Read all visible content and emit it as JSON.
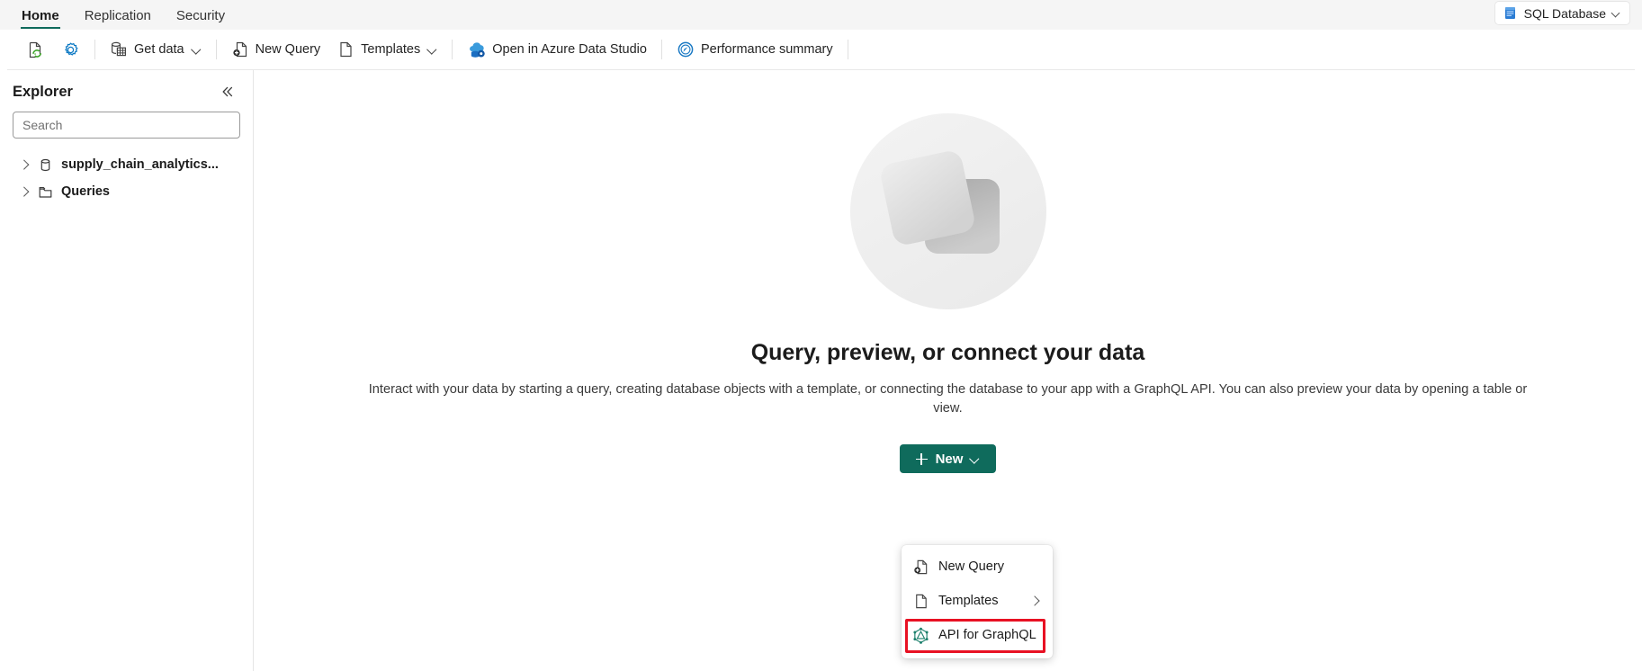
{
  "tabs": [
    {
      "label": "Home",
      "active": true
    },
    {
      "label": "Replication",
      "active": false
    },
    {
      "label": "Security",
      "active": false
    }
  ],
  "database_badge": {
    "label": "SQL Database",
    "icon": "database-icon",
    "chevron": "chevron-down-icon"
  },
  "toolbar": [
    {
      "name": "refresh",
      "label": "",
      "icon": "refresh-icon"
    },
    {
      "name": "settings",
      "label": "",
      "icon": "gear-icon"
    },
    {
      "name": "get-data",
      "label": "Get data",
      "icon": "database-table-icon",
      "has_chevron": true
    },
    {
      "name": "new-query",
      "label": "New Query",
      "icon": "new-query-icon"
    },
    {
      "name": "templates",
      "label": "Templates",
      "icon": "document-icon",
      "has_chevron": true
    },
    {
      "name": "open-in-azure-data-studio",
      "label": "Open in Azure Data Studio",
      "icon": "azure-data-studio-icon"
    },
    {
      "name": "performance-summary",
      "label": "Performance summary",
      "icon": "gauge-icon"
    }
  ],
  "sidebar": {
    "title": "Explorer",
    "collapse_icon": "double-chevron-left-icon",
    "search": {
      "placeholder": "Search",
      "value": ""
    },
    "tree": [
      {
        "label": "supply_chain_analytics...",
        "icon": "database-icon",
        "expanded": false
      },
      {
        "label": "Queries",
        "icon": "folder-icon",
        "expanded": false
      }
    ]
  },
  "main": {
    "illustration": "overlapping-squares-illustration",
    "headline": "Query, preview, or connect your data",
    "description": "Interact with your data by starting a query, creating database objects with a template, or connecting the database to your app with a GraphQL API. You can also preview your data by opening a table or view.",
    "new_button": {
      "label": "New",
      "icon": "plus-icon",
      "chevron": "chevron-down-icon"
    }
  },
  "menu": {
    "items": [
      {
        "label": "New Query",
        "icon": "new-query-icon",
        "has_submenu": false,
        "highlighted": false
      },
      {
        "label": "Templates",
        "icon": "document-icon",
        "has_submenu": true,
        "highlighted": false
      },
      {
        "label": "API for GraphQL",
        "icon": "graphql-icon",
        "has_submenu": false,
        "highlighted": true
      }
    ]
  },
  "colors": {
    "accent": "#0f6b5c",
    "highlight": "#e81123",
    "icon_blue": "#0078d4",
    "icon_green": "#3fa62b",
    "graphql": "#1a7f6b"
  }
}
